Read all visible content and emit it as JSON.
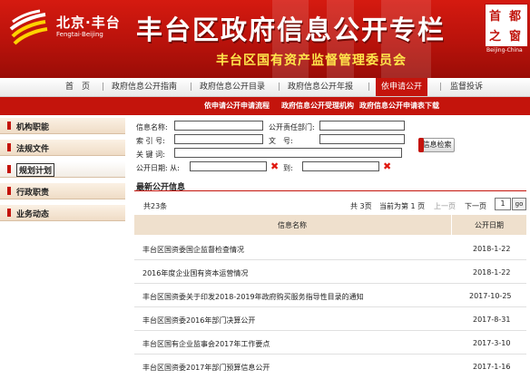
{
  "header": {
    "logo_cn": "北京·丰台",
    "logo_en": "Fengtai·Beijing",
    "main_title": "丰台区政府信息公开专栏",
    "sub_title": "丰台区国有资产监督管理委员会",
    "seal_chars": [
      "首",
      "都",
      "之",
      "窗"
    ],
    "seal_en": "Beijing-China"
  },
  "nav": {
    "items": [
      "首　页",
      "政府信息公开指南",
      "政府信息公开目录",
      "政府信息公开年报",
      "依申请公开",
      "监督投诉"
    ],
    "separator": "|",
    "active_index": 4
  },
  "subnav": {
    "items": [
      "依申请公开申请流程",
      "政府信息公开受理机构",
      "政府信息公开申请表下载"
    ]
  },
  "sidebar": {
    "items": [
      "机构职能",
      "法规文件",
      "规划计划",
      "行政职责",
      "业务动态"
    ],
    "active_index": 2
  },
  "search_form": {
    "name_label": "信息名称:",
    "dept_label": "公开责任部门:",
    "index_label": "索 引 号:",
    "docno_label": "文　号:",
    "keyword_label": "关 键 词:",
    "date_label": "公开日期: 从:",
    "to_label": "到:",
    "clear_mark": "✖",
    "button_label": "信息检索"
  },
  "latest": {
    "title": "最新公开信息",
    "total": "共23条",
    "pager": {
      "total_pages": "共 3页",
      "current": "当前为第 1 页",
      "first": "上一页",
      "next": "下一页",
      "page_input": "1",
      "go": "go"
    },
    "columns": [
      "信息名称",
      "公开日期"
    ],
    "rows": [
      {
        "name": "丰台区国资委国企监督检查情况",
        "date": "2018-1-22"
      },
      {
        "name": "2016年度企业国有资本运营情况",
        "date": "2018-1-22"
      },
      {
        "name": "丰台区国资委关于印发2018-2019年政府购买服务指导性目录的通知",
        "date": "2017-10-25"
      },
      {
        "name": "丰台区国资委2016年部门决算公开",
        "date": "2017-8-31"
      },
      {
        "name": "丰台区国有企业监事会2017年工作要点",
        "date": "2017-3-10"
      },
      {
        "name": "丰台区国资委2017年部门预算信息公开",
        "date": "2017-1-16"
      }
    ]
  },
  "colors": {
    "primary_red": "#c4140c",
    "title_yellow": "#ffe64b",
    "sidebar_bg": "#f3e3cf",
    "table_header_bg": "#efe0cd"
  }
}
